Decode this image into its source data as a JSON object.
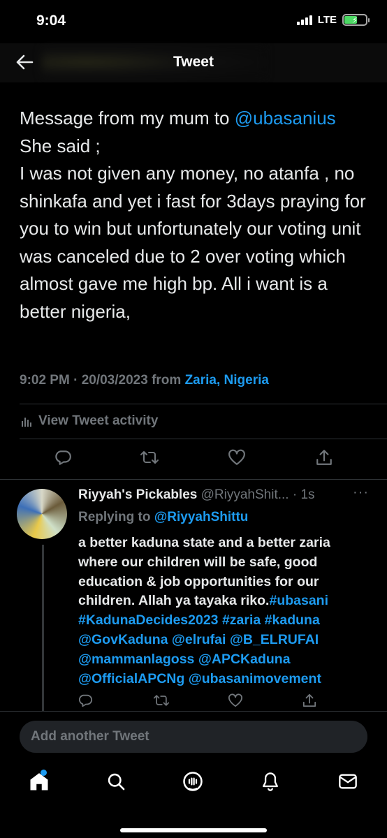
{
  "status_bar": {
    "time": "9:04",
    "network": "LTE"
  },
  "header": {
    "title": "Tweet"
  },
  "tweet": {
    "text_1": "Message from my mum to ",
    "mention": "@ubasanius",
    "text_2": "  She said ;\nI was not given any money, no atanfa , no shinkafa and yet i fast for 3days praying for you to win but unfortunately our voting unit was canceled due to 2 over voting which almost gave me high bp. All i want is a better nigeria,",
    "timestamp": "9:02 PM · 20/03/2023 from ",
    "location": "Zaria, Nigeria",
    "activity_label": "View Tweet activity"
  },
  "reply": {
    "name": "Riyyah's Pickables",
    "handle": "@RiyyahShit...",
    "time": " · 1s",
    "more": "···",
    "replying_prefix": "Replying to ",
    "replying_to": "@RiyyahShittu",
    "text_plain": "a better kaduna state and a better zaria where our children will be safe, good education & job opportunities for our children. Allah ya tayaka riko.",
    "tags": [
      "#ubasani",
      "#KadunaDecides2023",
      "#zaria",
      "#kaduna",
      "@GovKaduna",
      "@elrufai",
      "@B_ELRUFAI",
      "@mammanlagoss",
      "@APCKaduna",
      "@OfficialAPCNg",
      "@ubasanimovement"
    ]
  },
  "compose": {
    "placeholder": "Add another Tweet"
  },
  "icons": {
    "back": "arrow-left-icon",
    "actions": [
      "reply-icon",
      "retweet-icon",
      "like-icon",
      "share-icon"
    ],
    "tabs": [
      "home-icon",
      "search-icon",
      "spaces-icon",
      "notifications-icon",
      "messages-icon"
    ]
  },
  "colors": {
    "accent": "#1d9bf0",
    "muted": "#71767b",
    "background": "#000000",
    "text": "#e7e9ea"
  }
}
